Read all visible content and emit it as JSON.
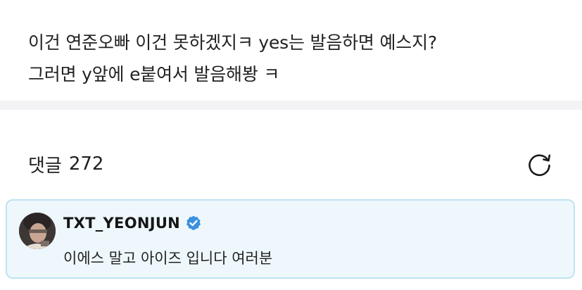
{
  "post": {
    "lines": [
      "이건 연준오빠 이건 못하겠지ㅋ yes는 발음하면 예스지?",
      "그러면 y앞에 e붙여서 발음해봥 ㅋ"
    ]
  },
  "comments": {
    "label": "댓글",
    "count": "272",
    "refresh_icon": "refresh-icon"
  },
  "artist_comment": {
    "author": "TXT_YEONJUN",
    "verified_icon": "verified-badge-icon",
    "text": "이에스 말고 아이즈 입니다 여러분",
    "highlight_color": "#eef8fc",
    "border_color": "#bfe3f1"
  }
}
